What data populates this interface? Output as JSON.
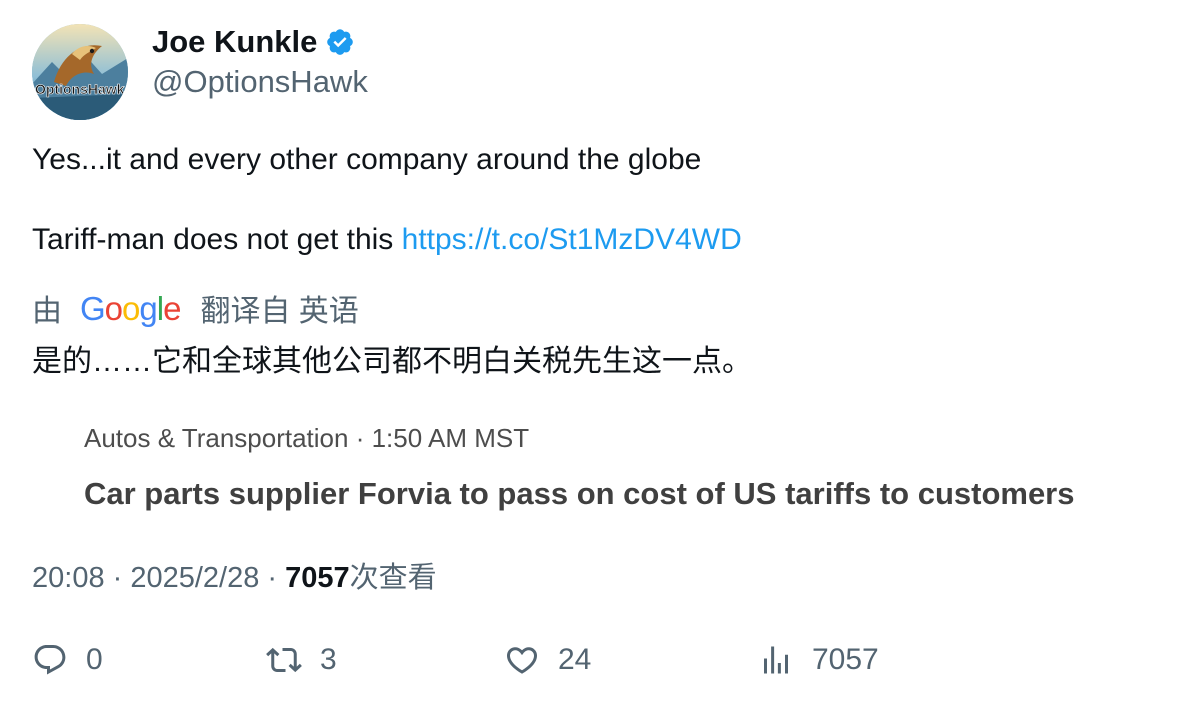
{
  "author": {
    "name": "Joe Kunkle",
    "handle": "@OptionsHawk",
    "avatar_text": "OptionsHawk"
  },
  "tweet": {
    "line1": "Yes...it and every other company around the globe",
    "line2_text": "Tariff-man does not get this ",
    "line2_link": "https://t.co/St1MzDV4WD"
  },
  "translation": {
    "by": "由",
    "provider": "Google",
    "source": "翻译自 英语",
    "text": "是的……它和全球其他公司都不明白关税先生这一点。"
  },
  "card": {
    "meta": "Autos & Transportation · 1:50 AM MST",
    "title": "Car parts supplier Forvia to pass on cost of US tariffs to customers"
  },
  "meta": {
    "time": "20:08",
    "sep1": " · ",
    "date": "2025/2/28",
    "sep2": " · ",
    "views": "7057",
    "views_suffix": "次查看"
  },
  "actions": {
    "replies": "0",
    "retweets": "3",
    "likes": "24",
    "views": "7057"
  },
  "colors": {
    "link": "#1d9bf0",
    "verified": "#1d9bf0",
    "muted": "#536471"
  },
  "icons": [
    "verified-badge-icon",
    "reply-icon",
    "retweet-icon",
    "like-icon",
    "views-icon"
  ]
}
